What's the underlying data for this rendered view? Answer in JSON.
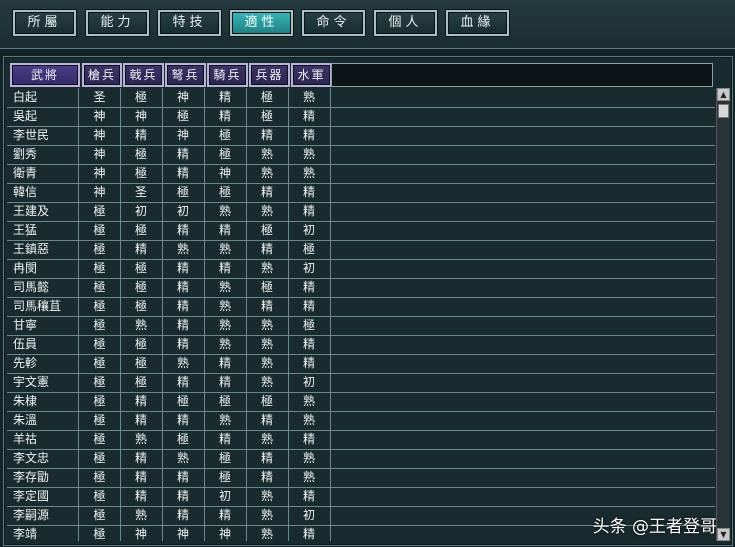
{
  "tabs": [
    {
      "label": "所屬",
      "active": false
    },
    {
      "label": "能力",
      "active": false
    },
    {
      "label": "特技",
      "active": false
    },
    {
      "label": "適性",
      "active": true
    },
    {
      "label": "命令",
      "active": false
    },
    {
      "label": "個人",
      "active": false
    },
    {
      "label": "血緣",
      "active": false
    }
  ],
  "columns": [
    "武將",
    "槍兵",
    "戟兵",
    "弩兵",
    "騎兵",
    "兵器",
    "水軍"
  ],
  "sorted_column": "槍兵",
  "rows": [
    [
      "白起",
      "圣",
      "極",
      "神",
      "精",
      "極",
      "熟"
    ],
    [
      "吳起",
      "神",
      "神",
      "極",
      "精",
      "極",
      "精"
    ],
    [
      "李世民",
      "神",
      "精",
      "神",
      "極",
      "精",
      "精"
    ],
    [
      "劉秀",
      "神",
      "極",
      "精",
      "極",
      "熟",
      "熟"
    ],
    [
      "衛青",
      "神",
      "極",
      "精",
      "神",
      "熟",
      "熟"
    ],
    [
      "韓信",
      "神",
      "圣",
      "極",
      "極",
      "精",
      "精"
    ],
    [
      "王建及",
      "極",
      "初",
      "初",
      "熟",
      "熟",
      "精"
    ],
    [
      "王猛",
      "極",
      "極",
      "精",
      "精",
      "極",
      "初"
    ],
    [
      "王鎮惡",
      "極",
      "精",
      "熟",
      "熟",
      "精",
      "極"
    ],
    [
      "冉閔",
      "極",
      "極",
      "精",
      "精",
      "熟",
      "初"
    ],
    [
      "司馬懿",
      "極",
      "極",
      "精",
      "熟",
      "極",
      "精"
    ],
    [
      "司馬穰苴",
      "極",
      "極",
      "精",
      "熟",
      "精",
      "精"
    ],
    [
      "甘寧",
      "極",
      "熟",
      "精",
      "熟",
      "熟",
      "極"
    ],
    [
      "伍員",
      "極",
      "極",
      "精",
      "熟",
      "熟",
      "精"
    ],
    [
      "先軫",
      "極",
      "極",
      "熟",
      "精",
      "熟",
      "精"
    ],
    [
      "宇文憲",
      "極",
      "極",
      "精",
      "精",
      "熟",
      "初"
    ],
    [
      "朱棣",
      "極",
      "精",
      "極",
      "極",
      "極",
      "熟"
    ],
    [
      "朱溫",
      "極",
      "精",
      "精",
      "熟",
      "精",
      "熟"
    ],
    [
      "羊祜",
      "極",
      "熟",
      "極",
      "精",
      "熟",
      "精"
    ],
    [
      "李文忠",
      "極",
      "精",
      "熟",
      "極",
      "精",
      "熟"
    ],
    [
      "李存勖",
      "極",
      "精",
      "精",
      "極",
      "精",
      "熟"
    ],
    [
      "李定國",
      "極",
      "精",
      "精",
      "初",
      "熟",
      "精"
    ],
    [
      "李嗣源",
      "極",
      "熟",
      "精",
      "精",
      "熟",
      "初"
    ],
    [
      "李靖",
      "極",
      "神",
      "神",
      "神",
      "熟",
      "精"
    ]
  ],
  "watermark": "头条 @王者登哥"
}
